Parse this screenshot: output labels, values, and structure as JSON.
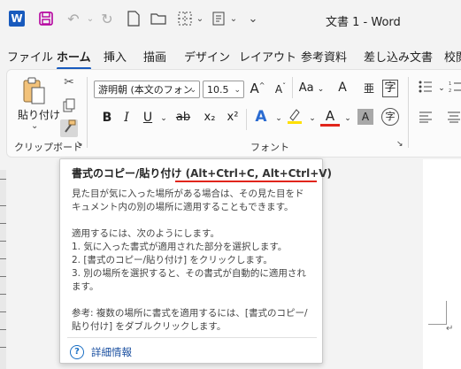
{
  "title_bar": {
    "app_logo": "W",
    "document_title": "文書 1 - Word",
    "quick_access_icons": [
      "save-icon",
      "undo-icon",
      "redo-icon",
      "new-document-icon",
      "open-folder-icon",
      "border-icon",
      "paragraph-marks-icon",
      "customize-toolbar-icon"
    ]
  },
  "tabs": [
    "ファイル",
    "ホーム",
    "挿入",
    "描画",
    "デザイン",
    "レイアウト",
    "参考資料",
    "差し込み文書",
    "校閲"
  ],
  "active_tab": "ホーム",
  "ribbon": {
    "clipboard": {
      "paste_label": "貼り付け",
      "paste_arrow": "⌄",
      "group_label": "クリップボード",
      "launcher": "↘"
    },
    "font": {
      "font_name": "游明朝 (本文のフォン",
      "font_size": "10.5",
      "group_label": "フォント",
      "launcher": "↘",
      "buttons": {
        "grow": "A",
        "shrink": "A",
        "case": "Aa",
        "clear": "A",
        "ruby": "亜",
        "bold": "B",
        "italic": "I",
        "underline": "U",
        "strike": "ab",
        "subscript": "x₂",
        "superscript": "x²",
        "effects": "A",
        "font_color": "A",
        "char_shading": "A",
        "enclose": "字"
      }
    }
  },
  "tooltip": {
    "title": "書式のコピー/貼り付け",
    "shortcut": "(Alt+Ctrl+C, Alt+Ctrl+V)",
    "body": "見た目が気に入った場所がある場合は、その見た目をドキュメント内の別の場所に適用することもできます。\n\n適用するには、次のようにします。\n1. 気に入った書式が適用された部分を選択します。\n2. [書式のコピー/貼り付け] をクリックします。\n3. 別の場所を選択すると、その書式が自動的に適用されます。\n\n参考: 複数の場所に書式を適用するには、[書式のコピー/貼り付け] をダブルクリックします。",
    "more_info": "詳細情報",
    "help_icon": "?"
  },
  "colors": {
    "accent": "#185abd",
    "underline_red": "#e1251b",
    "highlight_yellow": "#ffe000",
    "link_blue": "#1a4fa0"
  }
}
